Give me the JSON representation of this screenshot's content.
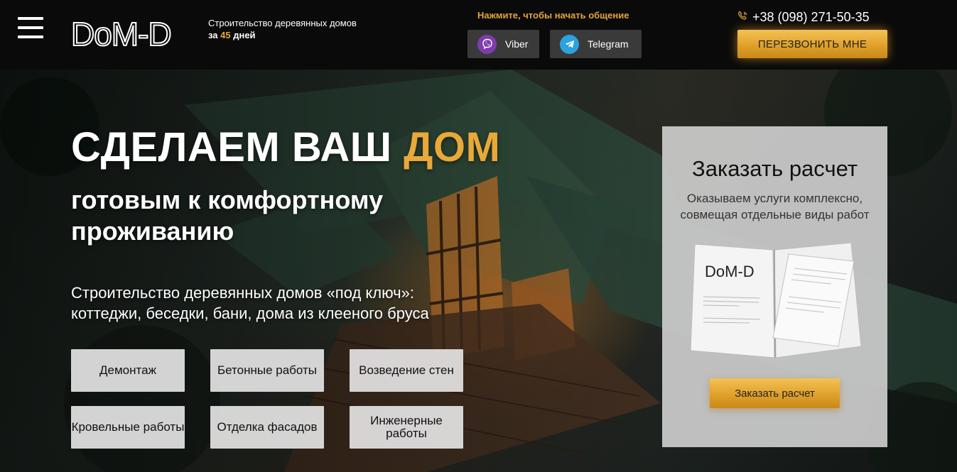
{
  "header": {
    "brand": "DoM-D",
    "tagline_line1": "Строительство деревянных домов",
    "tagline_line2_pre": "за ",
    "tagline_line2_num": "45",
    "tagline_line2_post": " дней",
    "chat_hint": "Нажмите, чтобы начать общение",
    "viber_label": "Viber",
    "telegram_label": "Telegram",
    "phone": "+38 (098) 271-50-35",
    "callback_label": "ПЕРЕЗВОНИТЬ МНЕ"
  },
  "hero": {
    "title_white": "СДЕЛАЕМ ВАШ ",
    "title_gold": "ДОМ",
    "subtitle": "готовым к комфортному проживанию",
    "lead": "Строительство деревянных домов «под ключ»: коттеджи, беседки, бани, дома из клееного бруса",
    "services": [
      "Демонтаж",
      "Бетонные работы",
      "Возведение стен",
      "Кровельные работы",
      "Отделка фасадов",
      "Инженерные работы"
    ]
  },
  "order_card": {
    "title": "Заказать расчет",
    "subtitle": "Оказываем услуги комплексно, совмещая отдельные виды работ",
    "book_logo": "DoM-D",
    "button_label": "Заказать расчет"
  },
  "colors": {
    "accent_gold": "#e8a939",
    "header_bg": "#0a0a0a",
    "viber": "#7d3daf",
    "telegram": "#2aa3df"
  }
}
